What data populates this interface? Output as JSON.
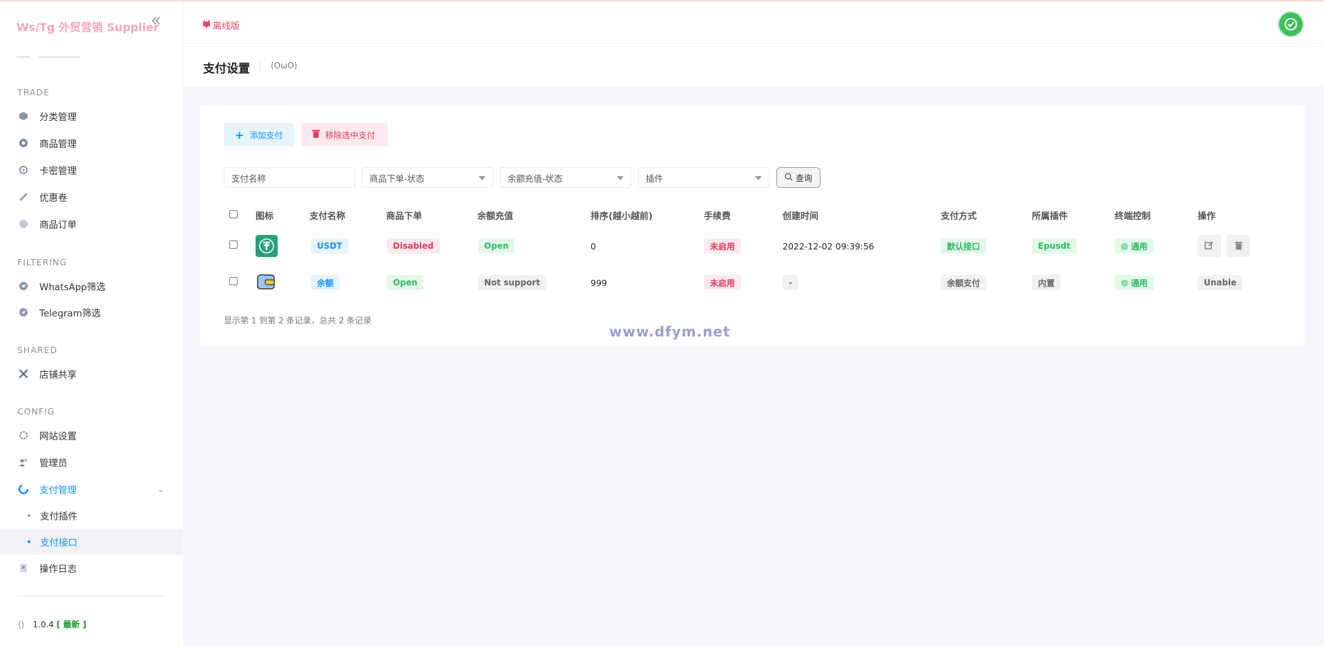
{
  "brand": {
    "title": "Ws/Tg 外贸营销 Supplier"
  },
  "sidebar": {
    "sections": [
      {
        "label": "TRADE",
        "items": [
          "分类管理",
          "商品管理",
          "卡密管理",
          "优惠卷",
          "商品订单"
        ]
      },
      {
        "label": "FILTERING",
        "items": [
          "WhatsApp筛选",
          "Telegram筛选"
        ]
      },
      {
        "label": "SHARED",
        "items": [
          "店铺共享"
        ]
      },
      {
        "label": "CONFIG",
        "items": [
          "网站设置",
          "管理员",
          "支付管理",
          "支付插件",
          "支付接口",
          "操作日志"
        ]
      }
    ],
    "version": "1.0.4",
    "version_badge": "[ 最新 ]"
  },
  "header": {
    "offline_label": "离线版"
  },
  "page": {
    "title": "支付设置",
    "face": "(ʘωʘ)"
  },
  "toolbar": {
    "add_label": "添加支付",
    "remove_label": "移除选中支付"
  },
  "filters": {
    "name_placeholder": "支付名称",
    "order_status": "商品下单-状态",
    "recharge_status": "余额充值-状态",
    "plugin": "插件",
    "query_label": "查询"
  },
  "table": {
    "headers": [
      "图标",
      "支付名称",
      "商品下单",
      "余额充值",
      "排序(越小越前)",
      "手续费",
      "创建时间",
      "支付方式",
      "所属插件",
      "终端控制",
      "操作"
    ],
    "rows": [
      {
        "name": "USDT",
        "order": "Disabled",
        "recharge": "Open",
        "sort": "0",
        "fee": "未启用",
        "created": "2022-12-02 09:39:56",
        "method": "默认接口",
        "plugin": "Epusdt",
        "terminal": "通用",
        "action": ""
      },
      {
        "name": "余额",
        "order": "Open",
        "recharge": "Not support",
        "sort": "999",
        "fee": "未启用",
        "created": "-",
        "method": "余额支付",
        "plugin": "内置",
        "terminal": "通用",
        "action": "Unable"
      }
    ],
    "footer": "显示第 1 到第 2 条记录，总共 2 条记录"
  },
  "watermark": "www.dfym.net",
  "colors": {
    "accent": "#1890ff",
    "danger": "#e03a5e",
    "success": "#2dba62",
    "brand": "#f5a9b8"
  }
}
